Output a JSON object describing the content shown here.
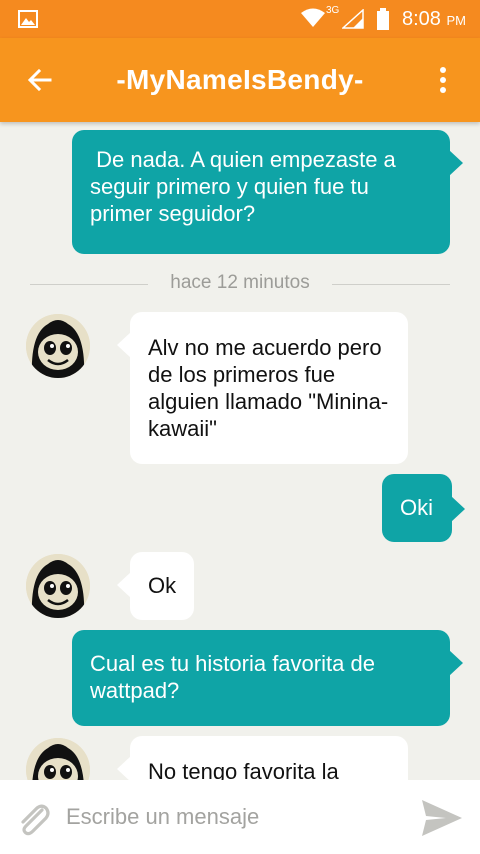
{
  "status_bar": {
    "network_type": "3G",
    "time": "8:08",
    "ampm": "PM",
    "icons": [
      "image-icon",
      "wifi-icon",
      "signal-icon",
      "battery-icon"
    ]
  },
  "header": {
    "title": "-MyNameIsBendy-",
    "back_icon": "arrow-left-icon",
    "menu_icon": "more-vertical-icon",
    "color": "#f7951e"
  },
  "messages": [
    {
      "direction": "out",
      "text": " De nada. A quien empezaste a seguir primero y quien fue tu primer seguidor?"
    },
    {
      "direction": "in",
      "text": "Alv no me acuerdo pero de los primeros fue alguien llamado \"Minina-kawaii\""
    },
    {
      "direction": "out",
      "text": "Oki"
    },
    {
      "direction": "in",
      "text": "Ok"
    },
    {
      "direction": "out",
      "text": "Cual es tu historia favorita de wattpad?"
    },
    {
      "direction": "in",
      "text": "No tengo favorita la"
    }
  ],
  "divider": {
    "label": "hace 12 minutos"
  },
  "composer": {
    "placeholder": "Escribe un mensaje",
    "attach_icon": "paperclip-icon",
    "send_icon": "send-icon"
  },
  "colors": {
    "outgoing_bubble": "#0fa4a6",
    "incoming_bubble": "#ffffff",
    "background": "#f1f1ec"
  }
}
